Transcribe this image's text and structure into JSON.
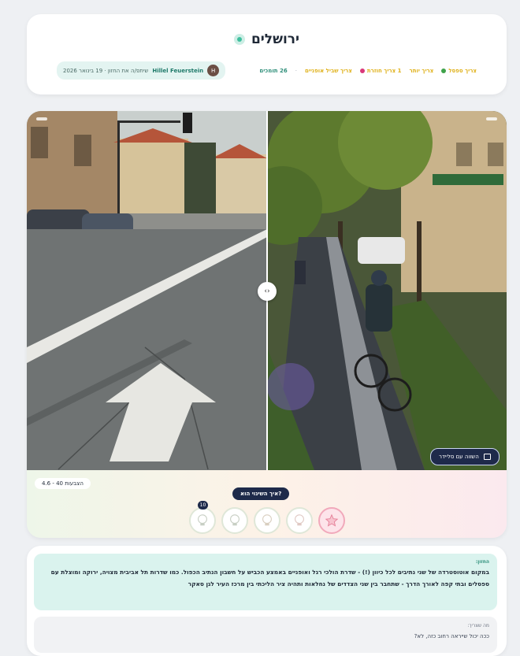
{
  "header": {
    "title": "ירושלים",
    "tags": [
      {
        "label": "צריך ספסל",
        "color": "#e0b21d",
        "dot_color": "#3fa24a"
      },
      {
        "label": "צריך יותר",
        "color": "#e0b21d"
      },
      {
        "label": "1 צריך חוזרת",
        "color": "#e0b21d",
        "dot_color": "#d9387a"
      },
      {
        "label": "צריך שביל אופניים",
        "color": "#e0b21d"
      },
      {
        "label": "26 תומכים",
        "color": "#2f8f7a"
      }
    ],
    "author": {
      "initial": "H",
      "name": "Hillel Feuerstein",
      "text": "שיתפ/ה את החזון · 19 בינואר 2026"
    }
  },
  "comparison": {
    "show_button_label": "השווה עם סליידר",
    "rating_label": "4.6 - 40 הצבעות",
    "question_label": "איך השינוי הוא?",
    "faces": [
      {
        "name": "face-1",
        "badge": "10"
      },
      {
        "name": "face-2"
      },
      {
        "name": "face-3"
      },
      {
        "name": "face-4"
      },
      {
        "name": "face-5",
        "selected": true
      }
    ]
  },
  "description": {
    "answer_label": "החזון:",
    "answer_text": "במקום אוטוסטרדה של שני נתיבים לכל כיוון (!) - שדרת הולכי רגל ואופניים באמצע הכביש על חשבון הנתיב הכפול. כמו שדרות תל אביבית מצויה, ירוקה ומוצלת עם ספסלים ובתי קפה לאורך הדרך - שתחבר בין שני הצדדים של נחלאות ותהיה ציר הליכתי בין מרכז העיר לגן סאקר",
    "note_label": "מה שצריך:",
    "note_text": "ככה יכול שייראה רחוב כזה, לא?"
  }
}
